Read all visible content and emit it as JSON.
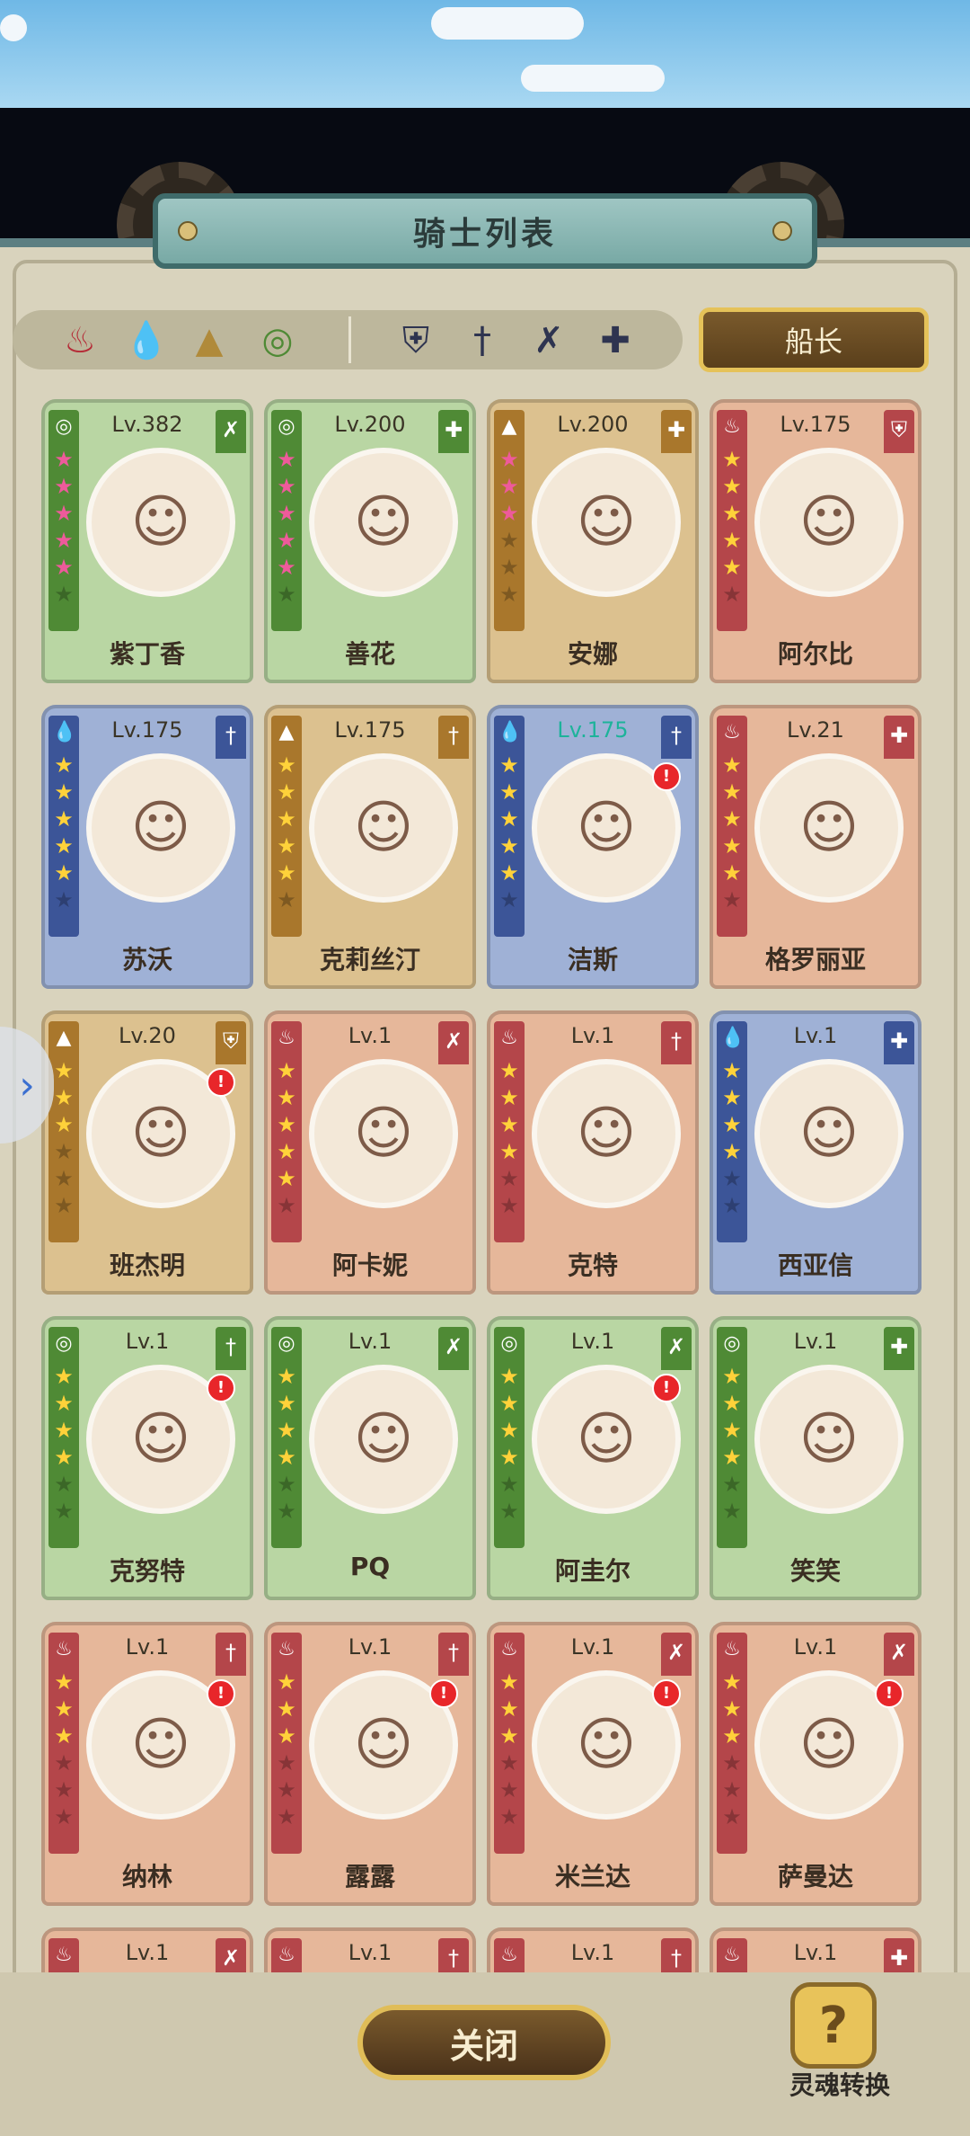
{
  "title": "骑士列表",
  "captain_label": "船长",
  "close_label": "关闭",
  "soul_label": "灵魂转换",
  "filters": {
    "elements": [
      {
        "icon": "fire-icon",
        "glyph": "♨",
        "color": "#b52a36"
      },
      {
        "icon": "water-icon",
        "glyph": "💧",
        "color": "#2f63b3"
      },
      {
        "icon": "earth-icon",
        "glyph": "▲",
        "color": "#b08a3a"
      },
      {
        "icon": "wind-icon",
        "glyph": "◎",
        "color": "#4f8a35"
      }
    ],
    "classes": [
      {
        "icon": "shield-icon",
        "glyph": "⛨"
      },
      {
        "icon": "sword-icon",
        "glyph": "†"
      },
      {
        "icon": "bow-icon",
        "glyph": "✗"
      },
      {
        "icon": "support-icon",
        "glyph": "✚"
      }
    ]
  },
  "knights": [
    {
      "name": "紫丁香",
      "level": "Lv.382",
      "theme": "green",
      "stars": 5,
      "star_color": "pink",
      "el": "◎",
      "cls": "✗",
      "alert": false,
      "hl": false
    },
    {
      "name": "善花",
      "level": "Lv.200",
      "theme": "green",
      "stars": 5,
      "star_color": "pink",
      "el": "◎",
      "cls": "✚",
      "alert": false,
      "hl": false
    },
    {
      "name": "安娜",
      "level": "Lv.200",
      "theme": "gold",
      "stars": 3,
      "star_color": "pink",
      "el": "▲",
      "cls": "✚",
      "alert": false,
      "hl": false
    },
    {
      "name": "阿尔比",
      "level": "Lv.175",
      "theme": "orange",
      "stars": 5,
      "star_color": "yellow",
      "el": "♨",
      "cls": "⛨",
      "alert": false,
      "hl": false
    },
    {
      "name": "苏沃",
      "level": "Lv.175",
      "theme": "blue",
      "stars": 5,
      "star_color": "yellow",
      "el": "💧",
      "cls": "†",
      "alert": false,
      "hl": false
    },
    {
      "name": "克莉丝汀",
      "level": "Lv.175",
      "theme": "gold",
      "stars": 5,
      "star_color": "yellow",
      "el": "▲",
      "cls": "†",
      "alert": false,
      "hl": false
    },
    {
      "name": "洁斯",
      "level": "Lv.175",
      "theme": "blue",
      "stars": 5,
      "star_color": "yellow",
      "el": "💧",
      "cls": "†",
      "alert": true,
      "hl": true
    },
    {
      "name": "格罗丽亚",
      "level": "Lv.21",
      "theme": "orange",
      "stars": 5,
      "star_color": "yellow",
      "el": "♨",
      "cls": "✚",
      "alert": false,
      "hl": false
    },
    {
      "name": "班杰明",
      "level": "Lv.20",
      "theme": "gold",
      "stars": 3,
      "star_color": "yellow",
      "el": "▲",
      "cls": "⛨",
      "alert": true,
      "hl": false
    },
    {
      "name": "阿卡妮",
      "level": "Lv.1",
      "theme": "orange",
      "stars": 5,
      "star_color": "yellow",
      "el": "♨",
      "cls": "✗",
      "alert": false,
      "hl": false
    },
    {
      "name": "克特",
      "level": "Lv.1",
      "theme": "orange",
      "stars": 4,
      "star_color": "yellow",
      "el": "♨",
      "cls": "†",
      "alert": false,
      "hl": false
    },
    {
      "name": "西亚信",
      "level": "Lv.1",
      "theme": "blue",
      "stars": 4,
      "star_color": "yellow",
      "el": "💧",
      "cls": "✚",
      "alert": false,
      "hl": false
    },
    {
      "name": "克努特",
      "level": "Lv.1",
      "theme": "green",
      "stars": 4,
      "star_color": "yellow",
      "el": "◎",
      "cls": "†",
      "alert": true,
      "hl": false
    },
    {
      "name": "PQ",
      "level": "Lv.1",
      "theme": "green",
      "stars": 4,
      "star_color": "yellow",
      "el": "◎",
      "cls": "✗",
      "alert": false,
      "hl": false
    },
    {
      "name": "阿圭尔",
      "level": "Lv.1",
      "theme": "green",
      "stars": 4,
      "star_color": "yellow",
      "el": "◎",
      "cls": "✗",
      "alert": true,
      "hl": false
    },
    {
      "name": "笑笑",
      "level": "Lv.1",
      "theme": "green",
      "stars": 4,
      "star_color": "yellow",
      "el": "◎",
      "cls": "✚",
      "alert": false,
      "hl": false
    },
    {
      "name": "纳林",
      "level": "Lv.1",
      "theme": "orange",
      "stars": 3,
      "star_color": "yellow",
      "el": "♨",
      "cls": "†",
      "alert": true,
      "hl": false
    },
    {
      "name": "露露",
      "level": "Lv.1",
      "theme": "orange",
      "stars": 3,
      "star_color": "yellow",
      "el": "♨",
      "cls": "†",
      "alert": true,
      "hl": false
    },
    {
      "name": "米兰达",
      "level": "Lv.1",
      "theme": "orange",
      "stars": 3,
      "star_color": "yellow",
      "el": "♨",
      "cls": "✗",
      "alert": true,
      "hl": false
    },
    {
      "name": "萨曼达",
      "level": "Lv.1",
      "theme": "orange",
      "stars": 3,
      "star_color": "yellow",
      "el": "♨",
      "cls": "✗",
      "alert": true,
      "hl": false
    },
    {
      "name": "",
      "level": "Lv.1",
      "theme": "orange",
      "stars": 3,
      "star_color": "yellow",
      "el": "♨",
      "cls": "✗",
      "alert": false,
      "hl": false
    },
    {
      "name": "",
      "level": "Lv.1",
      "theme": "orange",
      "stars": 3,
      "star_color": "yellow",
      "el": "♨",
      "cls": "†",
      "alert": false,
      "hl": false
    },
    {
      "name": "",
      "level": "Lv.1",
      "theme": "orange",
      "stars": 3,
      "star_color": "yellow",
      "el": "♨",
      "cls": "†",
      "alert": false,
      "hl": false
    },
    {
      "name": "",
      "level": "Lv.1",
      "theme": "orange",
      "stars": 3,
      "star_color": "yellow",
      "el": "♨",
      "cls": "✚",
      "alert": false,
      "hl": false
    }
  ]
}
